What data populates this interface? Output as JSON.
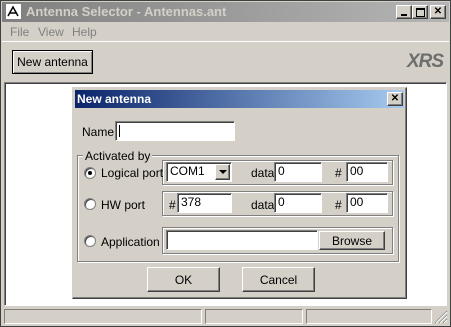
{
  "window": {
    "title": "Antenna Selector - Antennas.ant"
  },
  "menu": [
    "File",
    "View",
    "Help"
  ],
  "toolbar": {
    "new_antenna_label": "New antenna",
    "brand": "XRS"
  },
  "dialog": {
    "title": "New antenna",
    "name_label": "Name",
    "name_value": "",
    "group_label": "Activated by",
    "logical": {
      "label": "Logical port",
      "port": "COM1",
      "data_label": "data",
      "data_value": "0",
      "hash": "#",
      "num_value": "00",
      "selected": true
    },
    "hw": {
      "label": "HW port",
      "hash1": "#",
      "port_value": "378",
      "data_label": "data",
      "data_value": "0",
      "hash2": "#",
      "num_value": "00"
    },
    "app": {
      "label": "Application",
      "value": "",
      "browse_label": "Browse"
    },
    "ok_label": "OK",
    "cancel_label": "Cancel"
  },
  "colors": {
    "titlebar_active": "#0a246a",
    "titlebar_inactive": "#808080",
    "face": "#d4d0c8",
    "brand_text": "#6e6e6e"
  }
}
